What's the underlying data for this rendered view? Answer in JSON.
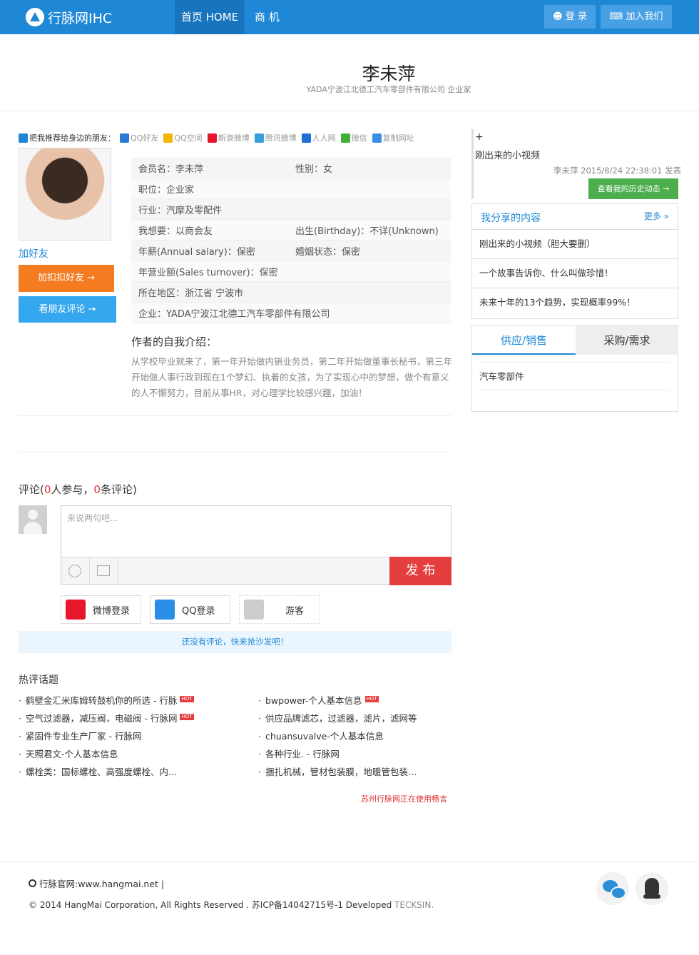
{
  "brand": {
    "logo_text": "行脉网IHC"
  },
  "nav": {
    "home": "首页 HOME",
    "business": "商 机"
  },
  "topbar": {
    "login": "登 录",
    "join": "加入我们"
  },
  "profile": {
    "name": "李未萍",
    "subtitle": "YADA宁波江北德工汽车零部件有限公司 企业家",
    "add_friend": "加好友",
    "btn_qq": "加扣扣好友 →",
    "btn_review": "看朋友评论 →"
  },
  "share": {
    "lead": "把我推荐给身边的朋友：",
    "items": [
      "QQ好友",
      "QQ空间",
      "新浪微博",
      "腾讯微博",
      "人人网",
      "微信",
      "复制网址"
    ]
  },
  "info": {
    "rows": [
      {
        "c1": "会员名：李未萍",
        "c2": "性别：女"
      },
      {
        "c1": "职位：企业家",
        "c2": ""
      },
      {
        "c1": "行业：汽摩及零配件",
        "c2": ""
      },
      {
        "c1": "我想要：以商会友",
        "c2": "出生(Birthday)：不详(Unknown)"
      },
      {
        "c1": "年薪(Annual salary)：保密",
        "c2": "婚姻状态：保密"
      },
      {
        "c1": "年营业额(Sales turnover)：保密",
        "c2": ""
      },
      {
        "c1": "所在地区：浙江省 宁波市",
        "c2": ""
      },
      {
        "c1": "企业：YADA宁波江北德工汽车零部件有限公司",
        "c2": ""
      }
    ]
  },
  "intro": {
    "title": "作者的自我介绍：",
    "text": "从学校毕业就来了，第一年开始做内销业务员，第二年开始做董事长秘书，第三年开始做人事行政到现在1个梦幻、执着的女孩，为了实现心中的梦想，做个有意义的人不懈努力，目前从事HR，对心理学比较感兴趣，加油！"
  },
  "latest": {
    "plus": "+",
    "title": "刚出来的小视频",
    "meta": "李未萍 2015/8/24 22:38:01 发表",
    "history_btn": "查看我的历史动态 →"
  },
  "shared": {
    "title": "我分享的内容",
    "more": "更多 »",
    "items": [
      "刚出来的小视频（胆大要删）",
      "一个故事告诉你、什么叫做珍惜！",
      "未来十年的13个趋势，实现概率99%！"
    ]
  },
  "tabs": {
    "supply": "供应/销售",
    "purchase": "采购/需求",
    "content": "汽车零部件"
  },
  "comments": {
    "prefix": "评论(",
    "participants": "0",
    "mid": "人参与，",
    "count": "0",
    "suffix": "条评论)",
    "placeholder": "来说两句吧...",
    "post": "发 布",
    "weibo_login": "微博登录",
    "qq_login": "QQ登录",
    "guest": "游客",
    "empty": "还没有评论，快来抢沙发吧！"
  },
  "hot": {
    "title": "热评话题",
    "badge": "HOT",
    "left": [
      {
        "text": "鹤壁金汇米库姆转鼓机你的所选 - 行脉",
        "hot": true
      },
      {
        "text": "空气过滤器，减压阀，电磁阀 - 行脉网",
        "hot": true
      },
      {
        "text": "紧固件专业生产厂家 - 行脉网",
        "hot": false
      },
      {
        "text": "天照君文-个人基本信息",
        "hot": false
      },
      {
        "text": "螺栓类：国标螺栓、高强度螺栓、内…",
        "hot": false
      }
    ],
    "right": [
      {
        "text": "bwpower-个人基本信息",
        "hot": true
      },
      {
        "text": "供应品牌滤芯，过滤器，滤片，滤网等",
        "hot": false
      },
      {
        "text": "chuansuvalve-个人基本信息",
        "hot": false
      },
      {
        "text": "各种行业. - 行脉网",
        "hot": false
      },
      {
        "text": "捆扎机械，管材包装膜，地暖管包装…",
        "hot": false
      }
    ],
    "powered": "苏州行脉网正在使用畅言"
  },
  "footer": {
    "site": "行脉官网:www.hangmai.net |",
    "copyright": "© 2014 HangMai Corporation, All Rights Reserved . 苏ICP备14042715号-1 Developed ",
    "developer": "TECKSIN."
  },
  "colors": {
    "primary": "#1e88d6",
    "orange": "#f47b20",
    "green": "#4cae4c",
    "red": "#e53e3e"
  }
}
